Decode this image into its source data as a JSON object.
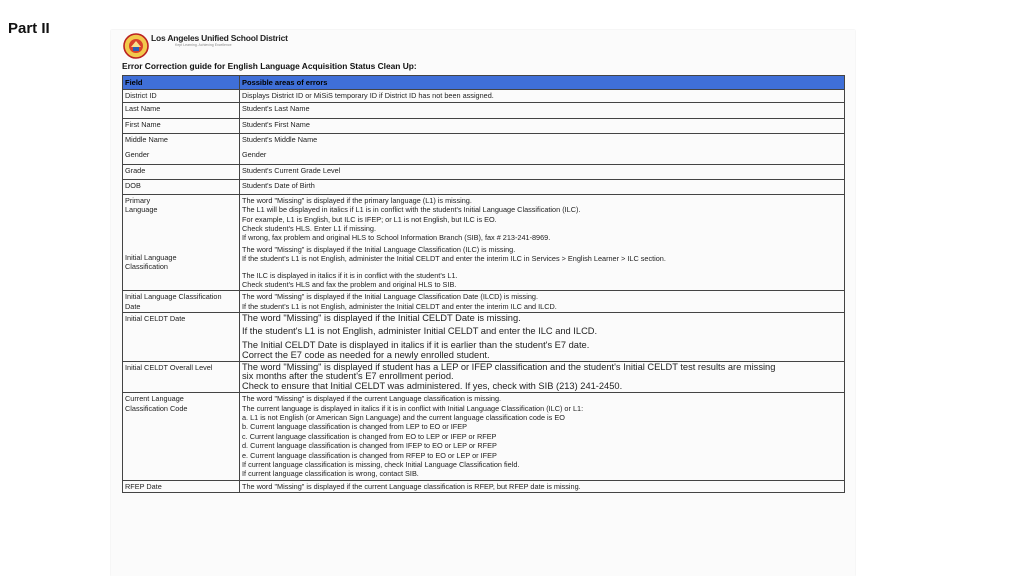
{
  "slide": {
    "title": "Part II"
  },
  "header": {
    "org_name": "Los Angeles Unified School District",
    "org_subtitle": "Kept Learning. Achieving Excellence"
  },
  "guide": {
    "title": "Error Correction guide for English Language Acquisition Status Clean Up:"
  },
  "table": {
    "headers": [
      "Field",
      "Possible areas of errors"
    ],
    "rows": {
      "district_id": {
        "field": "District ID",
        "text": "Displays District ID or MiSiS temporary ID if District ID has not been assigned."
      },
      "last_name": {
        "field": "Last Name",
        "text": "Student's Last Name"
      },
      "first_name": {
        "field": "First Name",
        "text": "Student's First Name"
      },
      "middle_gender": {
        "field1": "Middle Name",
        "field2": "Gender",
        "text1": "Student's Middle Name",
        "text2": "Gender"
      },
      "grade": {
        "field": "Grade",
        "text": "Student's Current Grade Level"
      },
      "dob": {
        "field": "DOB",
        "text": "Student's Date of Birth"
      },
      "primary_ilc": {
        "field1": "Primary Language",
        "field2": "Initial Language Classification",
        "lines": [
          "The word \"Missing\" is displayed if the primary language (L1) is missing.",
          "The L1 will be displayed in italics if L1 is in conflict with the student's Initial Language Classification (ILC).",
          "For example, L1 is English, but ILC is IFEP; or L1 is not English, but ILC is EO.",
          "Check student's HLS. Enter L1 if missing.",
          "If wrong, fax problem and original HLS to School Information Branch (SIB), fax # 213-241-8969.",
          "The word \"Missing\" is displayed if the Initial Language Classification (ILC) is missing.",
          "If the student's L1 is not English, administer the Initial CELDT and enter the interim ILC in Services > English Learner > ILC section.",
          "The ILC is displayed in italics if it is in conflict with the student's L1.",
          "Check student's HLS and fax the problem and original HLS to SIB."
        ]
      },
      "ilc_date": {
        "field": "Initial Language Classification Date",
        "lines": [
          "The word \"Missing\" is displayed if the Initial Language Classification Date (ILCD) is missing.",
          "If the student's L1 is not English, administer the Initial CELDT and enter the interim ILC  and ILCD."
        ]
      },
      "celdt_date": {
        "field": "Initial CELDT Date",
        "lines": [
          "The word \"Missing\" is displayed if the Initial CELDT Date is missing.",
          "If the student's L1 is not English, administer Initial CELDT and enter the ILC and ILCD.",
          "The Initial CELDT Date is displayed in italics if it is earlier than the student's E7 date.",
          "Correct the E7 code as needed for a newly enrolled student."
        ]
      },
      "celdt_overall": {
        "field": "Initial CELDT Overall Level",
        "lines": [
          "The word \"Missing\" is displayed if student has a LEP or IFEP classification and the student's Initial CELDT test results are missing",
          "six months after the student's E7 enrollment period.",
          "Check to ensure that Initial CELDT was administered. If yes, check with SIB (213) 241-2450."
        ]
      },
      "current_lang": {
        "field": "Current Language Classification Code",
        "lines": [
          "The word \"Missing\" is displayed if the current Language classification is missing.",
          "The current language is displayed in italics if it is in conflict with Initial Language Classification (ILC) or L1:",
          "a. L1 is not English (or American Sign Language) and the current language classification code is EO",
          "b. Current language classification is changed from LEP to EO or IFEP",
          "c. Current language classification is changed from EO to LEP or IFEP or RFEP",
          "d. Current language classification is changed from IFEP to EO or LEP or RFEP",
          "e. Current language classification is changed from RFEP to EO or LEP or IFEP",
          "If current language classification is missing, check Initial Language Classification field.",
          "If current language classification is wrong, contact SIB."
        ]
      },
      "rfep_date": {
        "field": "RFEP Date",
        "text": "The word \"Missing\" is displayed if the current Language classification is RFEP, but RFEP date is missing."
      }
    }
  }
}
